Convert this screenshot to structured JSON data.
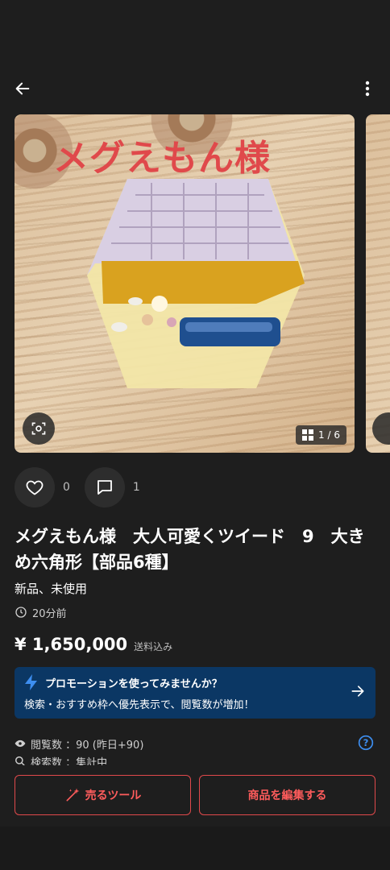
{
  "photo": {
    "caption": "メグえもん様",
    "index": "1 / 6"
  },
  "actions": {
    "like_count": "0",
    "comment_count": "1"
  },
  "item": {
    "title": "メグえもん様　大人可愛くツイード　9　大きめ六角形【部品6種】",
    "condition": "新品、未使用",
    "posted_time": "20分前",
    "price": "¥ 1,650,000",
    "shipping": "送料込み"
  },
  "promo": {
    "title": "プロモーションを使ってみませんか？",
    "subtitle": "検索・おすすめ枠へ優先表示で、閲覧数が増加！"
  },
  "stats": {
    "views": "閲覧数 ：90 (昨日+90)",
    "searches": "検索数 ：集計中"
  },
  "buttons": {
    "sell_tools": "売るツール",
    "edit_item": "商品を編集する"
  },
  "colors": {
    "accent": "#e0494b",
    "promo_bg": "#0b3764",
    "background": "#1e1e1e"
  }
}
